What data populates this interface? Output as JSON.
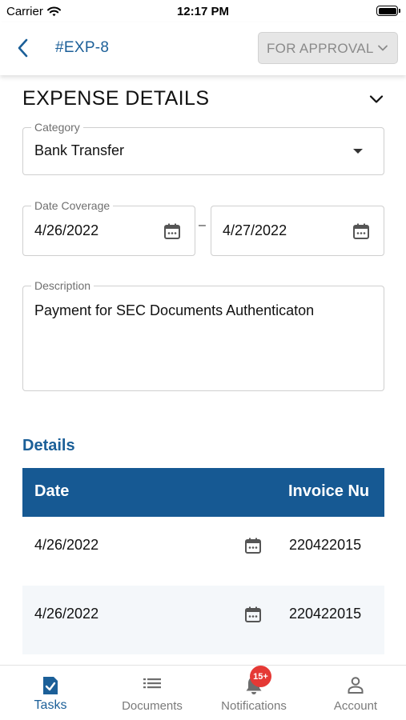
{
  "status_bar": {
    "carrier": "Carrier",
    "time": "12:17 PM"
  },
  "header": {
    "title": "#EXP-8",
    "status_dropdown": "FOR APPROVAL"
  },
  "expense_details": {
    "title": "EXPENSE DETAILS",
    "category": {
      "label": "Category",
      "value": "Bank Transfer"
    },
    "date_coverage": {
      "label": "Date Coverage",
      "start": "4/26/2022",
      "separator": "–",
      "end": "4/27/2022"
    },
    "description": {
      "label": "Description",
      "value": "Payment for SEC Documents Authenticaton"
    }
  },
  "details": {
    "heading": "Details",
    "columns": [
      "Date",
      "Invoice Nu"
    ],
    "rows": [
      {
        "date": "4/26/2022",
        "invoice": "220422015"
      },
      {
        "date": "4/26/2022",
        "invoice": "220422015"
      }
    ]
  },
  "tab_bar": {
    "tabs": [
      {
        "label": "Tasks",
        "icon": "task-check-icon",
        "active": true
      },
      {
        "label": "Documents",
        "icon": "list-icon",
        "active": false
      },
      {
        "label": "Notifications",
        "icon": "bell-icon",
        "active": false
      },
      {
        "label": "Account",
        "icon": "person-icon",
        "active": false
      }
    ],
    "notification_badge": "15+"
  },
  "colors": {
    "primary": "#1b5f98",
    "table_header": "#165993",
    "badge": "#e53935",
    "inactive": "#7a7a7a"
  }
}
